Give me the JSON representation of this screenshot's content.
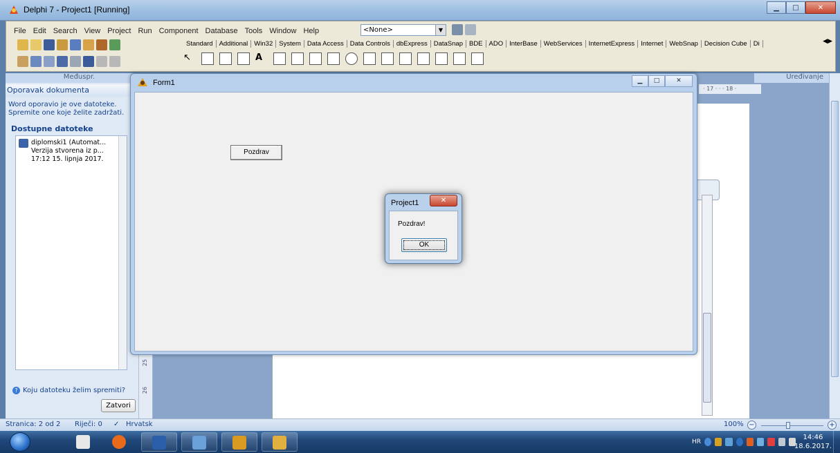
{
  "delphi": {
    "title": "Delphi 7 - Project1 [Running]",
    "menu": [
      "File",
      "Edit",
      "Search",
      "View",
      "Project",
      "Run",
      "Component",
      "Database",
      "Tools",
      "Window",
      "Help"
    ],
    "config_combo": "<None>",
    "palette_tabs": [
      "Standard",
      "Additional",
      "Win32",
      "System",
      "Data Access",
      "Data Controls",
      "dbExpress",
      "DataSnap",
      "BDE",
      "ADO",
      "InterBase",
      "WebServices",
      "InternetExpress",
      "Internet",
      "WebSnap",
      "Decision Cube",
      "Di"
    ]
  },
  "word": {
    "left_panel_header": "Međuspr.",
    "recovery_title": "Oporavak dokumenta",
    "recovery_msg_1": "Word oporavio je ove datoteke.",
    "recovery_msg_2": "Spremite one koje želite zadržati.",
    "available_files": "Dostupne datoteke",
    "file": {
      "name": "diplomski1 (Automat...",
      "version": "Verzija stvorena iz p...",
      "timestamp": "17:12 15. lipnja 2017."
    },
    "save_question": "Koju datoteku želim spremiti?",
    "close_button": "Zatvori",
    "right_header": "Uređivanje",
    "ruler_text": "· 17 · · · 18 ·",
    "status": {
      "page": "Stranica: 2 od 2",
      "words": "Riječi: 0",
      "language": "Hrvatsk",
      "zoom": "100%"
    }
  },
  "form1": {
    "title": "Form1",
    "button_label": "Pozdrav"
  },
  "message_box": {
    "title": "Project1",
    "text": "Pozdrav!",
    "ok_label": "OK"
  },
  "taskbar": {
    "language": "HR",
    "time": "14:46",
    "date": "18.6.2017."
  },
  "icons": {
    "start": "windows-orb-icon",
    "close": "close-icon"
  }
}
